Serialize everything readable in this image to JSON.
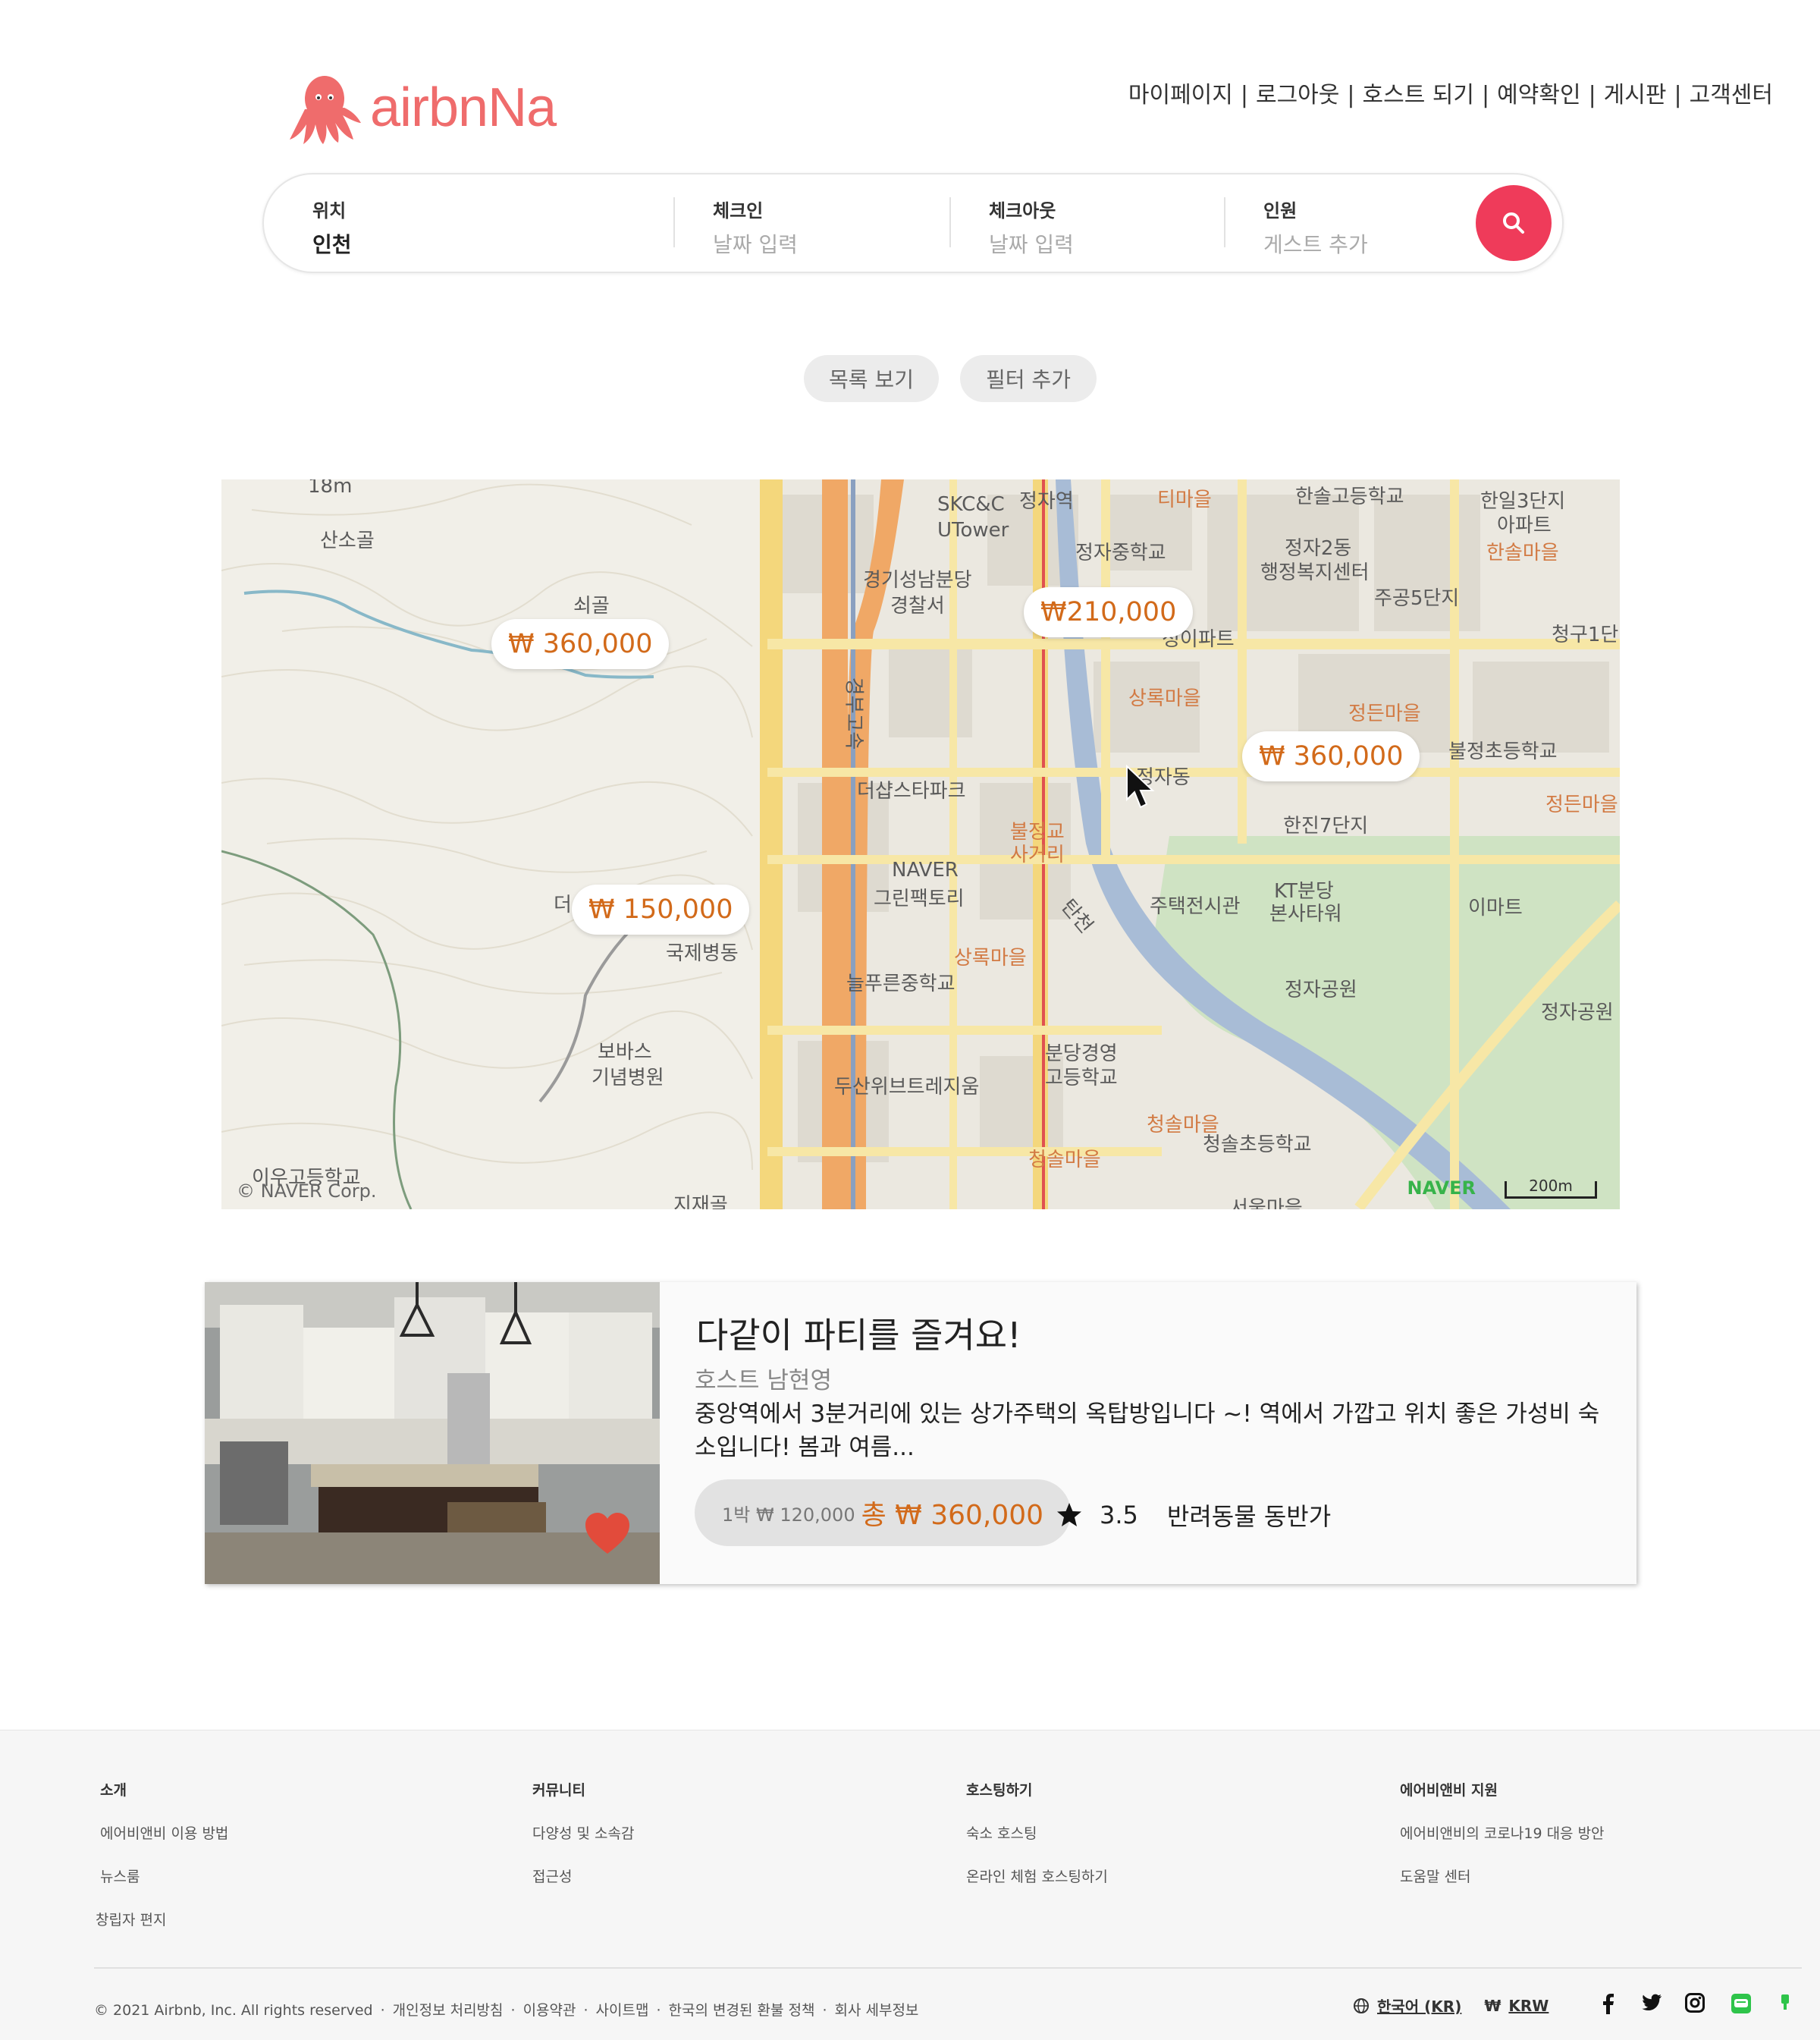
{
  "brand": {
    "name": "airbnNa",
    "color": "#ef6c6c"
  },
  "topnav": [
    "마이페이지",
    "로그아웃",
    "호스트 되기",
    "예약확인",
    "게시판",
    "고객센터"
  ],
  "topnav_separator": "|",
  "search": {
    "location": {
      "label": "위치",
      "value": "인천"
    },
    "checkin": {
      "label": "체크인",
      "placeholder": "날짜 입력"
    },
    "checkout": {
      "label": "체크아웃",
      "placeholder": "날짜 입력"
    },
    "guests": {
      "label": "인원",
      "placeholder": "게스트 추가"
    },
    "button_icon": "search-icon",
    "button_color": "#ef3b5a"
  },
  "actions": {
    "list_view": "목록 보기",
    "add_filter": "필터 추가"
  },
  "map": {
    "price_pins": [
      "₩ 360,000",
      "₩210,000",
      "₩ 360,000",
      "₩ 150,000"
    ],
    "labels": [
      "산소골",
      "쇠골",
      "SKC&C",
      "UTower",
      "정자역",
      "티마을",
      "한솔고등학교",
      "한일3단지",
      "아파트",
      "한솔마을",
      "정자중학교",
      "정자2동",
      "행정복지센터",
      "주공5단지",
      "경기성남분당",
      "경찰서",
      "청구1단",
      "정이파트",
      "상록마을",
      "정든마을",
      "불정초등학교",
      "정자동",
      "더샵스타파크",
      "한진7단지",
      "정든마을",
      "불정교",
      "사거리",
      "NAVER",
      "그린팩토리",
      "주택전시관",
      "KT분당",
      "본사타워",
      "이마트",
      "탄천",
      "국제병동",
      "더",
      "상록마을",
      "늘푸른중학교",
      "정자공원",
      "정자공원",
      "보바스",
      "기념병원",
      "두산위브트레지움",
      "분당경영",
      "고등학교",
      "청솔마을",
      "청솔초등학교",
      "청솔마을",
      "이우고등학교",
      "경부고속",
      "지재골",
      "서울마을",
      "18m"
    ],
    "copyright": "© NAVER Corp.",
    "naver_logo": "NAVER",
    "scale": "200m"
  },
  "listing": {
    "title": "다같이 파티를 즐겨요!",
    "host": "호스트 남현영",
    "description": "중앙역에서 3분거리에 있는 상가주택의 옥탑방입니다 ~! 역에서 가깝고 위치 좋은 가성비 숙소입니다! 봄과 여름...",
    "per_night": "1박 ₩ 120,000",
    "total": "총 ₩ 360,000",
    "rating": "3.5",
    "pet": "반려동물 동반가",
    "favorite_icon": "heart-icon",
    "favorite_color": "#e24b3b"
  },
  "footer": {
    "columns": [
      {
        "heading": "소개",
        "items": [
          "에어비앤비 이용 방법",
          "뉴스룸",
          "창립자 편지"
        ]
      },
      {
        "heading": "커뮤니티",
        "items": [
          "다양성 및 소속감",
          "접근성"
        ]
      },
      {
        "heading": "호스팅하기",
        "items": [
          "숙소 호스팅",
          "온라인 체험 호스팅하기"
        ]
      },
      {
        "heading": "에어비앤비 지원",
        "items": [
          "에어비앤비의 코로나19 대응 방안",
          "도움말 센터"
        ]
      }
    ],
    "copyright": "© 2021 Airbnb, Inc. All rights reserved",
    "links": [
      "개인정보 처리방침",
      "이용약관",
      "사이트맵",
      "한국의 변경된 환불 정책",
      "회사 세부정보"
    ],
    "language": "한국어 (KR)",
    "currency_symbol": "₩",
    "currency": "KRW",
    "social_icons": [
      "facebook-icon",
      "twitter-icon",
      "instagram-icon",
      "line-icon",
      "naver-blog-icon"
    ]
  }
}
